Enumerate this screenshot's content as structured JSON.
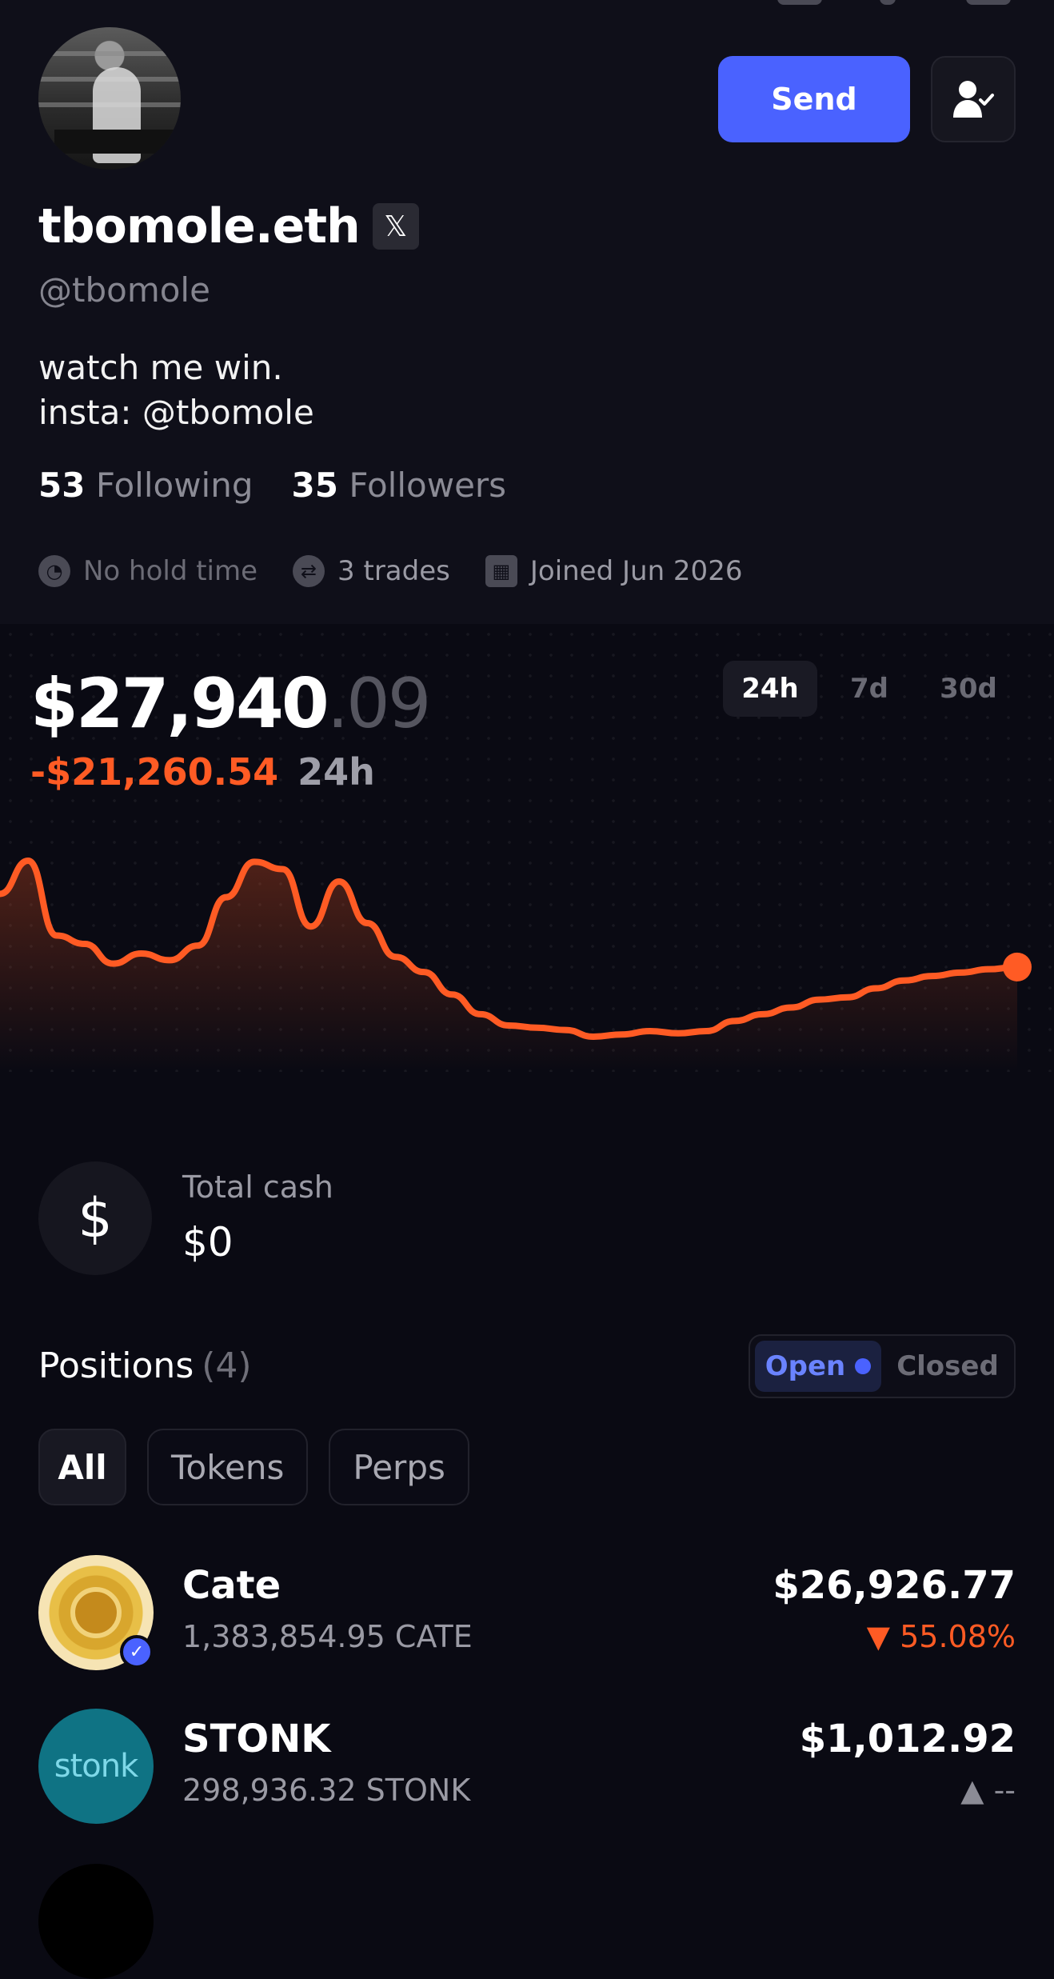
{
  "profile": {
    "name": "tbomole.eth",
    "x_badge": "𝕏",
    "handle": "@tbomole",
    "bio_line1": "watch me win.",
    "bio_line2": "insta: @tbomole",
    "following_count": "53",
    "following_label": "Following",
    "followers_count": "35",
    "followers_label": "Followers",
    "hold_time": "No hold time",
    "trades": "3 trades",
    "joined": "Joined Jun 2026"
  },
  "actions": {
    "send_label": "Send",
    "follow_icon": "user-check-icon"
  },
  "portfolio": {
    "value_main": "$27,940",
    "value_cents": ".09",
    "change_value": "-$21,260.54",
    "change_period": "24h",
    "ranges": [
      "24h",
      "7d",
      "30d"
    ],
    "selected_range": "24h",
    "line_color": "#ff5b24"
  },
  "chart_data": {
    "type": "line",
    "title": "",
    "xlabel": "",
    "ylabel": "",
    "x": [
      0,
      1,
      2,
      3,
      4,
      5,
      6,
      7,
      8,
      9,
      10,
      11,
      12,
      13,
      14,
      15,
      16,
      17,
      18,
      19,
      20,
      21,
      22,
      23,
      24,
      25,
      26,
      27,
      28,
      29,
      30,
      31,
      32,
      33,
      34,
      35,
      36
    ],
    "y": [
      29240,
      29830,
      28500,
      28350,
      28000,
      28180,
      28060,
      28320,
      29180,
      29810,
      29680,
      28660,
      29460,
      28720,
      28120,
      27850,
      27450,
      27100,
      26900,
      26860,
      26820,
      26700,
      26740,
      26800,
      26760,
      26800,
      26980,
      27100,
      27220,
      27360,
      27400,
      27560,
      27700,
      27780,
      27840,
      27900,
      27940
    ]
  },
  "cash": {
    "label": "Total cash",
    "value": "$0",
    "icon": "dollar-icon"
  },
  "positions": {
    "title": "Positions",
    "count": "(4)",
    "toggle_open": "Open",
    "toggle_closed": "Closed",
    "filters": [
      "All",
      "Tokens",
      "Perps"
    ],
    "items": [
      {
        "name": "Cate",
        "qty": "1,383,854.95 CATE",
        "value": "$26,926.77",
        "change": "▼ 55.08%"
      },
      {
        "name": "STONK",
        "qty": "298,936.32 STONK",
        "value": "$1,012.92",
        "change": "▲ --",
        "logo_text": "stonk"
      }
    ]
  }
}
